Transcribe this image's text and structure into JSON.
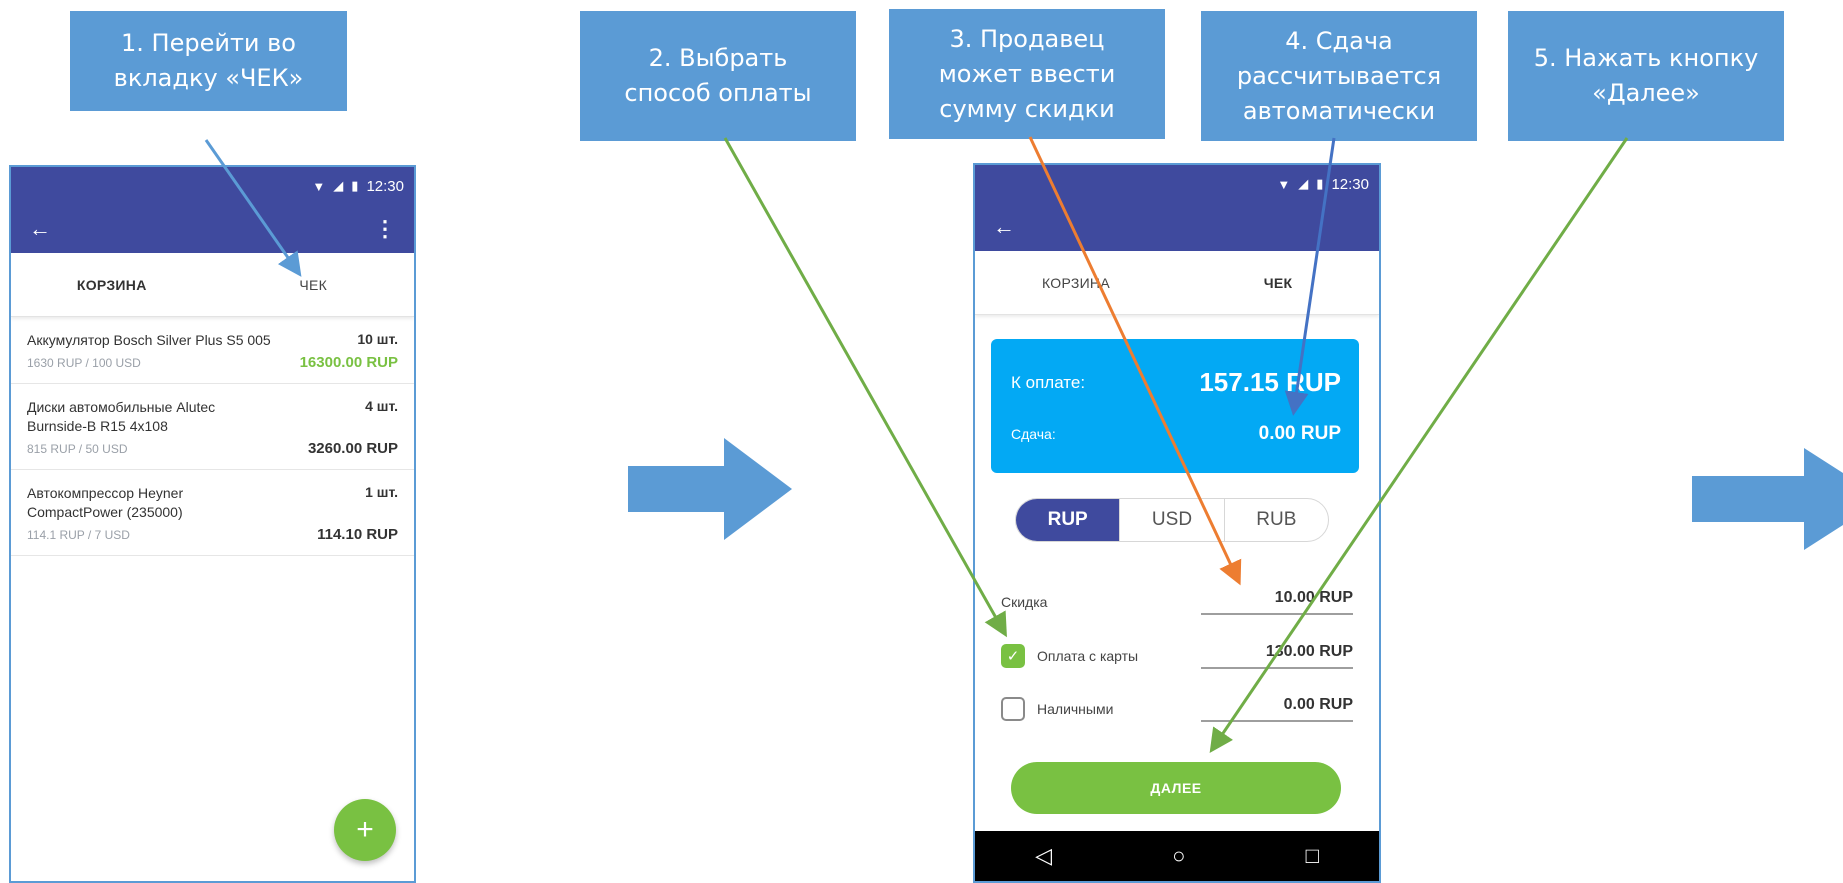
{
  "callouts": {
    "step1": "1.  Перейти во\nвкладку «ЧЕК»",
    "step2": "2. Выбрать\nспособ оплаты",
    "step3": "3. Продавец\nможет ввести\nсумму скидки",
    "step4": "4. Сдача\nрассчитывается\nавтоматически",
    "step5": "5. Нажать кнопку\n«Далее»"
  },
  "status_bar": {
    "time": "12:30"
  },
  "icons": {
    "back": "arrow-left-icon",
    "menu": "more-vert-icon",
    "add": "plus-icon",
    "check": "checkmark-icon",
    "nav_back": "triangle-back-icon",
    "nav_home": "circle-home-icon",
    "nav_recent": "square-recent-icon"
  },
  "screen1": {
    "tabs": [
      "КОРЗИНА",
      "ЧЕК"
    ],
    "items": [
      {
        "name": "Аккумулятор Bosch Silver Plus S5 005",
        "qty": "10 шт.",
        "price": "1630 RUP / 100 USD",
        "total": "16300.00 RUP",
        "highlight": true
      },
      {
        "name": "Диски автомобильные Alutec Burnside-B R15 4x108",
        "qty": "4 шт.",
        "price": "815 RUP / 50 USD",
        "total": "3260.00 RUP",
        "highlight": false
      },
      {
        "name": "Автокомпрессор Heyner CompactPower (235000)",
        "qty": "1 шт.",
        "price": "114.1 RUP / 7 USD",
        "total": "114.10 RUP",
        "highlight": false
      }
    ],
    "fab": "+"
  },
  "screen2": {
    "tabs": [
      "КОРЗИНА",
      "ЧЕК"
    ],
    "pay_label": "К оплате:",
    "pay_value": "157.15 RUP",
    "change_label": "Сдача:",
    "change_value": "0.00 RUP",
    "currencies": [
      "RUP",
      "USD",
      "RUB"
    ],
    "discount_label": "Скидка",
    "discount_value": "10.00 RUP",
    "card_label": "Оплата с карты",
    "card_value": "130.00 RUP",
    "card_checked": true,
    "cash_label": "Наличными",
    "cash_value": "0.00 RUP",
    "cash_checked": false,
    "next_label": "ДАЛЕЕ"
  },
  "colors": {
    "primary": "#3f4a9e",
    "accent_green": "#79c142",
    "pay_card": "#03a9f4",
    "callout": "#5b9bd5",
    "arrow_green": "#70ad47",
    "arrow_orange": "#ed7d31",
    "arrow_blue": "#4472c4",
    "arrow_light": "#5b9bd5"
  }
}
